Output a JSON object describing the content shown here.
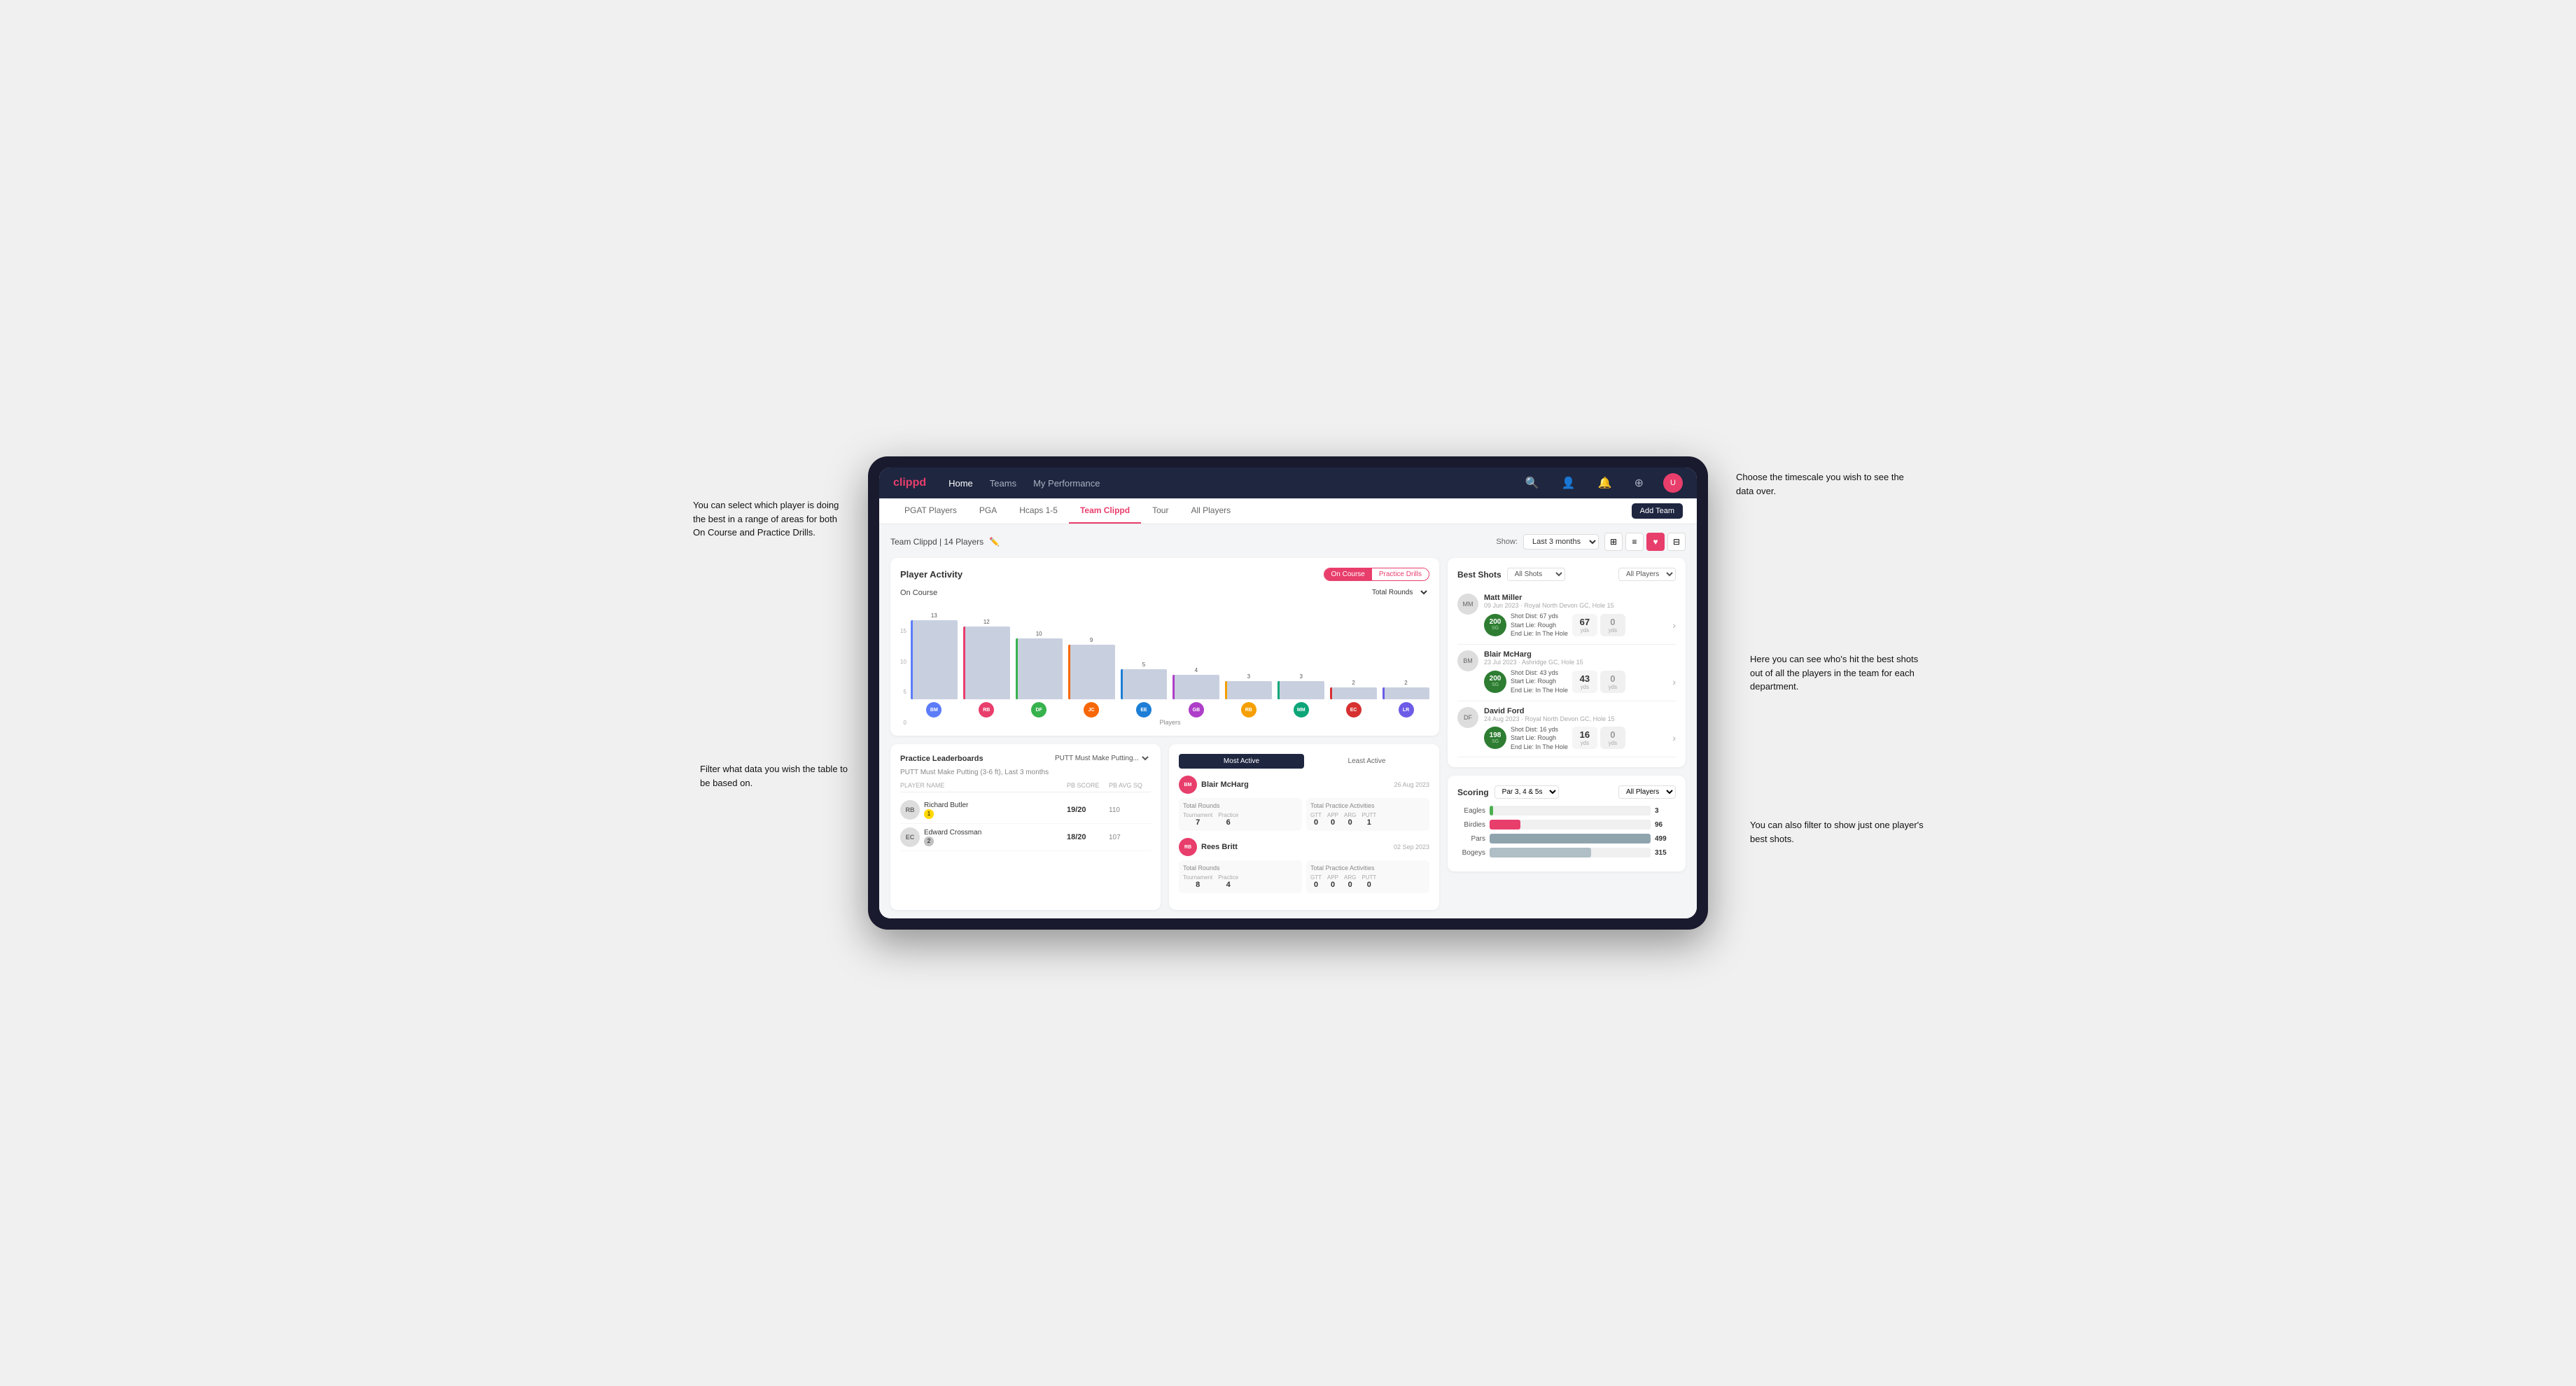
{
  "annotations": {
    "top_left": "You can select which player is doing the best in a range of areas for both On Course and Practice Drills.",
    "bottom_left": "Filter what data you wish the table to be based on.",
    "top_right": "Choose the timescale you wish to see the data over.",
    "mid_right": "Here you can see who's hit the best shots out of all the players in the team for each department.",
    "bottom_right": "You can also filter to show just one player's best shots."
  },
  "nav": {
    "brand": "clippd",
    "links": [
      "Home",
      "Teams",
      "My Performance"
    ],
    "active_link": "My Performance"
  },
  "sub_tabs": {
    "tabs": [
      "PGAT Players",
      "PGA",
      "Hcaps 1-5",
      "Team Clippd",
      "Tour",
      "All Players"
    ],
    "active": "Team Clippd",
    "add_button": "Add Team"
  },
  "team_header": {
    "name": "Team Clippd | 14 Players",
    "show_label": "Show:",
    "time_period": "Last 3 months"
  },
  "player_activity": {
    "title": "Player Activity",
    "toggle": [
      "On Course",
      "Practice Drills"
    ],
    "active_toggle": "On Course",
    "section_label": "On Course",
    "chart_filter": "Total Rounds",
    "x_axis_label": "Players",
    "y_labels": [
      "0",
      "5",
      "10",
      "15"
    ],
    "bars": [
      {
        "name": "B. McHarg",
        "value": 13,
        "color": "#c8d0e0"
      },
      {
        "name": "R. Britt",
        "value": 12,
        "color": "#c8d0e0"
      },
      {
        "name": "D. Ford",
        "value": 10,
        "color": "#c8d0e0"
      },
      {
        "name": "J. Coles",
        "value": 9,
        "color": "#c8d0e0"
      },
      {
        "name": "E. Ebert",
        "value": 5,
        "color": "#c8d0e0"
      },
      {
        "name": "G. Billingham",
        "value": 4,
        "color": "#c8d0e0"
      },
      {
        "name": "R. Butler",
        "value": 3,
        "color": "#c8d0e0"
      },
      {
        "name": "M. Miller",
        "value": 3,
        "color": "#c8d0e0"
      },
      {
        "name": "E. Crossman",
        "value": 2,
        "color": "#c8d0e0"
      },
      {
        "name": "L. Robertson",
        "value": 2,
        "color": "#c8d0e0"
      }
    ]
  },
  "leaderboard": {
    "title": "Practice Leaderboards",
    "drill": "PUTT Must Make Putting...",
    "subtitle": "PUTT Must Make Putting (3-6 ft), Last 3 months",
    "headers": [
      "PLAYER NAME",
      "PB SCORE",
      "PB AVG SQ"
    ],
    "players": [
      {
        "name": "Richard Butler",
        "badge": "1",
        "score": "19/20",
        "avg": "110"
      },
      {
        "name": "Edward Crossman",
        "badge": "2",
        "score": "18/20",
        "avg": "107"
      }
    ]
  },
  "most_active": {
    "tabs": [
      "Most Active",
      "Least Active"
    ],
    "active_tab": "Most Active",
    "players": [
      {
        "name": "Blair McHarg",
        "date": "26 Aug 2023",
        "total_rounds_label": "Total Rounds",
        "tournament": "7",
        "practice": "6",
        "total_practice_label": "Total Practice Activities",
        "gtt": "0",
        "app": "0",
        "arg": "0",
        "putt": "1"
      },
      {
        "name": "Rees Britt",
        "date": "02 Sep 2023",
        "total_rounds_label": "Total Rounds",
        "tournament": "8",
        "practice": "4",
        "total_practice_label": "Total Practice Activities",
        "gtt": "0",
        "app": "0",
        "arg": "0",
        "putt": "0"
      }
    ]
  },
  "best_shots": {
    "title": "Best Shots",
    "filter": "All Shots",
    "players_filter": "All Players",
    "shots": [
      {
        "player": "Matt Miller",
        "meta": "09 Jun 2023 · Royal North Devon GC, Hole 15",
        "badge_num": "200",
        "badge_label": "SG",
        "dist_line1": "Shot Dist: 67 yds",
        "dist_line2": "Start Lie: Rough",
        "dist_line3": "End Lie: In The Hole",
        "stat1_value": "67",
        "stat1_unit": "yds",
        "stat2_value": "0",
        "stat2_unit": "yds"
      },
      {
        "player": "Blair McHarg",
        "meta": "23 Jul 2023 · Ashridge GC, Hole 15",
        "badge_num": "200",
        "badge_label": "SG",
        "dist_line1": "Shot Dist: 43 yds",
        "dist_line2": "Start Lie: Rough",
        "dist_line3": "End Lie: In The Hole",
        "stat1_value": "43",
        "stat1_unit": "yds",
        "stat2_value": "0",
        "stat2_unit": "yds"
      },
      {
        "player": "David Ford",
        "meta": "24 Aug 2023 · Royal North Devon GC, Hole 15",
        "badge_num": "198",
        "badge_label": "SG",
        "dist_line1": "Shot Dist: 16 yds",
        "dist_line2": "Start Lie: Rough",
        "dist_line3": "End Lie: In The Hole",
        "stat1_value": "16",
        "stat1_unit": "yds",
        "stat2_value": "0",
        "stat2_unit": "yds"
      }
    ]
  },
  "scoring": {
    "title": "Scoring",
    "filter": "Par 3, 4 & 5s",
    "players_filter": "All Players",
    "categories": [
      {
        "label": "Eagles",
        "value": 3,
        "max": 500,
        "color": "#4caf50",
        "class": "eagles"
      },
      {
        "label": "Birdies",
        "value": 96,
        "max": 500,
        "color": "#e83e6c",
        "class": "birdies"
      },
      {
        "label": "Pars",
        "value": 499,
        "max": 500,
        "color": "#90a4ae",
        "class": "pars"
      },
      {
        "label": "Bogeys",
        "value": 315,
        "max": 500,
        "color": "#b0bec5",
        "class": "bogeys"
      }
    ]
  },
  "avatars": {
    "colors": [
      "#5c7cfa",
      "#e83e6c",
      "#37b24d",
      "#f76707",
      "#1c7ed6",
      "#ae3ec9",
      "#f59f00",
      "#0ca678",
      "#d63031",
      "#6c5ce7"
    ]
  }
}
